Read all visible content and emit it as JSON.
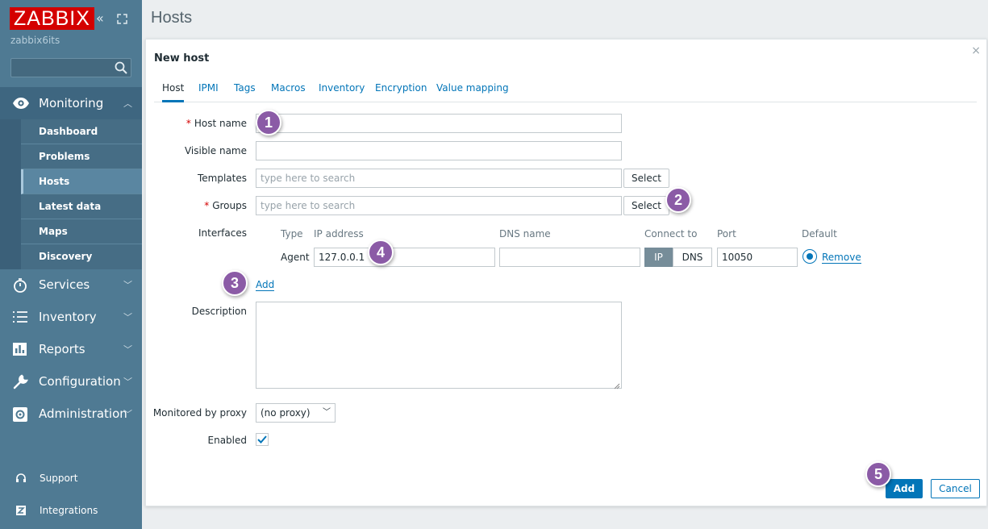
{
  "sidebar": {
    "logo": "ZABBIX",
    "server_name": "zabbix6its",
    "collapse_glyph": "«",
    "search_placeholder": "",
    "monitoring": {
      "label": "Monitoring",
      "items": [
        "Dashboard",
        "Problems",
        "Hosts",
        "Latest data",
        "Maps",
        "Discovery"
      ],
      "current": "Hosts"
    },
    "menu": [
      "Services",
      "Inventory",
      "Reports",
      "Configuration",
      "Administration"
    ],
    "footer": [
      "Support",
      "Integrations"
    ]
  },
  "page_title": "Hosts",
  "modal": {
    "title": "New host",
    "close_glyph": "×",
    "tabs": [
      "Host",
      "IPMI",
      "Tags",
      "Macros",
      "Inventory",
      "Encryption",
      "Value mapping"
    ],
    "active_tab": "Host",
    "form": {
      "host_name_label": "Host name",
      "host_name_value": "",
      "visible_name_label": "Visible name",
      "visible_name_value": "",
      "templates_label": "Templates",
      "templates_placeholder": "type here to search",
      "groups_label": "Groups",
      "groups_placeholder": "type here to search",
      "select_label": "Select",
      "interfaces_label": "Interfaces",
      "interfaces": {
        "headers": [
          "Type",
          "IP address",
          "DNS name",
          "Connect to",
          "Port",
          "Default"
        ],
        "row": {
          "type": "Agent",
          "ip": "127.0.0.1",
          "dns": "",
          "connect_options": [
            "IP",
            "DNS"
          ],
          "connect_selected": "IP",
          "port": "10050",
          "remove_label": "Remove"
        },
        "add_label": "Add"
      },
      "description_label": "Description",
      "description_value": "",
      "proxy_label": "Monitored by proxy",
      "proxy_value": "(no proxy)",
      "enabled_label": "Enabled",
      "enabled": true
    },
    "buttons": {
      "add": "Add",
      "cancel": "Cancel"
    }
  },
  "callouts": [
    "1",
    "2",
    "3",
    "4",
    "5"
  ],
  "colors": {
    "sidebar": "#4f7a93",
    "accent": "#0275b8",
    "logo": "#d40000",
    "callout": "#8b5ba6"
  }
}
